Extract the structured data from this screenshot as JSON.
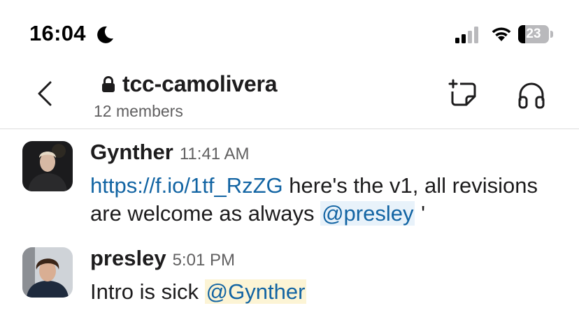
{
  "status_bar": {
    "time": "16:04",
    "battery_percent": "23",
    "battery_level": 0.23,
    "icons": [
      "moon-icon",
      "cellular-signal-icon",
      "wifi-icon",
      "battery-icon"
    ]
  },
  "header": {
    "channel_name": "tcc-camolivera",
    "member_count": "12 members",
    "icons": [
      "back-chevron-icon",
      "lock-icon",
      "canvas-icon",
      "headphones-icon"
    ]
  },
  "messages": [
    {
      "author": "Gynther",
      "time": "11:41 AM",
      "link": "https://f.io/1tf_RzZG",
      "text_1": " here's the v1, all revisions are welcome as always ",
      "mention": "@presley",
      "text_2": " '"
    },
    {
      "author": "presley",
      "time": "5:01 PM",
      "text_1": "Intro is sick ",
      "mention": "@Gynther"
    }
  ],
  "colors": {
    "link": "#1264a3",
    "mention_bg": "#e8f2fa",
    "self_mention_bg": "#fcf4d5",
    "secondary_text": "#616061"
  }
}
